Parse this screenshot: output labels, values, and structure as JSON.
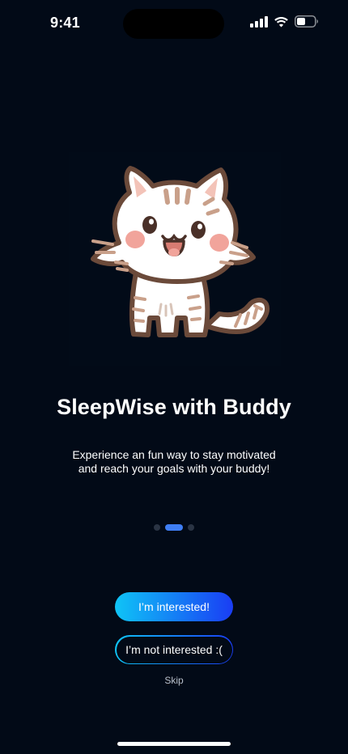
{
  "status_bar": {
    "time": "9:41",
    "icons": [
      "cellular-signal-icon",
      "wifi-icon",
      "battery-icon"
    ]
  },
  "illustration": {
    "name": "buddy-cat-illustration"
  },
  "onboarding": {
    "title": "SleepWise with Buddy",
    "subtitle_line1": "Experience an fun way to stay motivated",
    "subtitle_line2": "and reach your goals with your buddy!",
    "pager": {
      "total_pages": 3,
      "current_page": 2
    }
  },
  "actions": {
    "primary_label": "I’m interested!",
    "secondary_label": "I’m not interested :(",
    "skip_label": "Skip"
  },
  "colors": {
    "background": "#020a17",
    "accent_start": "#0fc4f6",
    "accent_end": "#1a3df4",
    "pager_active": "#3f7ef3",
    "pager_inactive": "#2a3444"
  }
}
